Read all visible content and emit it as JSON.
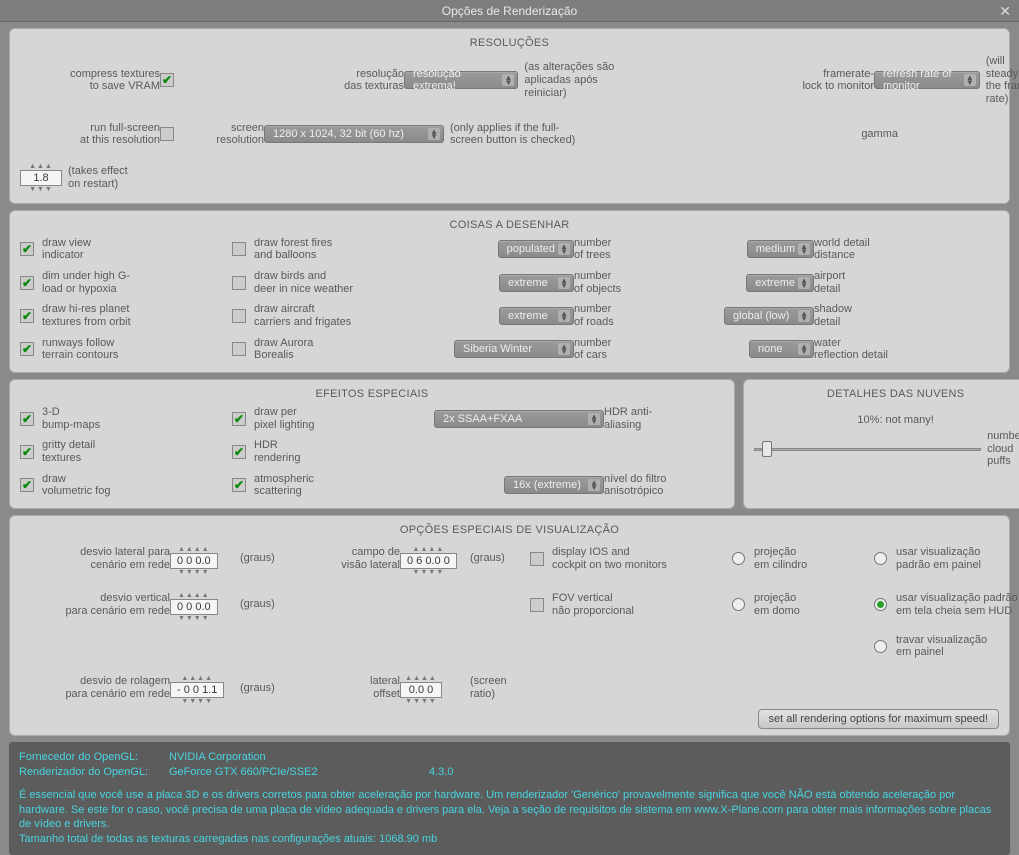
{
  "title": "Opções de Renderização",
  "sections": {
    "res": {
      "title": "RESOLUÇÕES",
      "compress": {
        "l1": "compress textures",
        "l2": "to save VRAM",
        "checked": true
      },
      "texres": {
        "l1": "resolução",
        "l2": "das texturas",
        "value": "resolução extrema!",
        "note1": "(as alterações são",
        "note2": "aplicadas após reiniciar)"
      },
      "fps": {
        "l1": "framerate-",
        "l2": "lock to monitor",
        "value": "refresh rate of monitor",
        "note1": "(will steady",
        "note2": "the frame-rate)"
      },
      "runfs": {
        "l1": "run full-screen",
        "l2": "at this resolution",
        "checked": false
      },
      "screen": {
        "l1": "screen",
        "l2": "resolution",
        "value": "1280 x 1024, 32 bit (60 hz)",
        "note1": "(only applies if the full-",
        "note2": "screen button is checked)"
      },
      "gamma": {
        "label": "gamma",
        "value": "1.8",
        "note1": "(takes effect",
        "note2": "on restart)"
      }
    },
    "draw": {
      "title": "COISAS A DESENHAR",
      "chk": [
        {
          "l1": "draw view",
          "l2": "indicator",
          "checked": true
        },
        {
          "l1": "dim under high G-",
          "l2": "load or hypoxia",
          "checked": true
        },
        {
          "l1": "draw hi-res planet",
          "l2": "textures from orbit",
          "checked": true
        },
        {
          "l1": "runways follow",
          "l2": "terrain contours",
          "checked": true
        },
        {
          "l1": "draw forest fires",
          "l2": "and balloons",
          "checked": false
        },
        {
          "l1": "draw birds and",
          "l2": "deer in nice weather",
          "checked": false
        },
        {
          "l1": "draw aircraft",
          "l2": "carriers and frigates",
          "checked": false
        },
        {
          "l1": "draw Aurora",
          "l2": "Borealis",
          "checked": false
        }
      ],
      "cb": [
        {
          "val": "populated",
          "l1": "number",
          "l2": "of trees"
        },
        {
          "val": "extreme",
          "l1": "number",
          "l2": "of objects"
        },
        {
          "val": "extreme",
          "l1": "number",
          "l2": "of roads"
        },
        {
          "val": "Siberia Winter",
          "l1": "number",
          "l2": "of cars"
        },
        {
          "val": "medium",
          "l1": "world detail",
          "l2": "distance"
        },
        {
          "val": "extreme",
          "l1": "airport",
          "l2": "detail"
        },
        {
          "val": "global (low)",
          "l1": "shadow",
          "l2": "detail"
        },
        {
          "val": "none",
          "l1": "water",
          "l2": "reflection detail"
        }
      ]
    },
    "fx": {
      "title": "EFEITOS ESPECIAIS",
      "chk": [
        {
          "l1": "3-D",
          "l2": "bump-maps",
          "checked": true
        },
        {
          "l1": "gritty detail",
          "l2": "textures",
          "checked": true
        },
        {
          "l1": "draw",
          "l2": "volumetric fog",
          "checked": true
        },
        {
          "l1": "draw per",
          "l2": "pixel lighting",
          "checked": true
        },
        {
          "l1": "HDR",
          "l2": "rendering",
          "checked": true
        },
        {
          "l1": "atmospheric",
          "l2": "scattering",
          "checked": true
        }
      ],
      "cb": [
        {
          "val": "2x SSAA+FXAA",
          "l1": "HDR anti-",
          "l2": "aliasing"
        },
        {
          "val": "16x (extreme)",
          "l1": "nível do filtro",
          "l2": "anisotrópico"
        }
      ]
    },
    "clouds": {
      "title": "DETALHES DAS NUVENS",
      "slider_label": "10%: not many!",
      "note1": "number of",
      "note2": "cloud puffs"
    },
    "vis": {
      "title": "OPÇÕES ESPECIAIS DE VISUALIZAÇÃO",
      "sp": [
        {
          "l1": "desvio lateral para",
          "l2": "cenário em rede",
          "val": "0 0 0.0",
          "unit": "(graus)"
        },
        {
          "l1": "desvio vertical",
          "l2": "para cenário em rede",
          "val": "0 0 0.0",
          "unit": "(graus)"
        },
        {
          "l1": "desvio de rolagem",
          "l2": "para cenário em rede",
          "val": "- 0 0 1.1",
          "unit": "(graus)"
        },
        {
          "l1": "campo de",
          "l2": "visão lateral",
          "val": "0 6 0.0 0",
          "unit": "(graus)"
        },
        {
          "l1": "lateral",
          "l2": "offset",
          "val": "0.0 0",
          "unit1": "(screen",
          "unit2": "ratio)"
        }
      ],
      "chk": [
        {
          "l1": "display IOS and",
          "l2": "cockpit on two monitors",
          "checked": false
        },
        {
          "l1": "FOV vertical",
          "l2": "não proporcional",
          "checked": false
        }
      ],
      "rad1": [
        {
          "l1": "projeção",
          "l2": "em cilindro",
          "checked": false
        },
        {
          "l1": "projeção",
          "l2": "em domo",
          "checked": false
        }
      ],
      "rad2": [
        {
          "l1": "usar visualização",
          "l2": "padrão em painel",
          "checked": false
        },
        {
          "l1": "usar visualização padrão",
          "l2": "em tela cheia sem HUD",
          "checked": true
        },
        {
          "l1": "travar visualização",
          "l2": "em painel",
          "checked": false
        }
      ],
      "btn": "set all rendering options for maximum speed!"
    },
    "info": {
      "vendor_l": "Fornecedor do OpenGL:",
      "vendor_v": "NVIDIA Corporation",
      "render_l": "Renderizador do OpenGL:",
      "render_v": "GeForce GTX 660/PCIe/SSE2",
      "version": "4.3.0",
      "blurb": "É essencial que você use a placa 3D e os drivers corretos para obter aceleração por hardware. Um renderizador 'Genérico' provavelmente significa que você NÃO está obtendo aceleração por hardware. Se este for o caso, você precisa de uma placa de vídeo adequada e drivers para ela. Veja a seção de requisitos de sistema em www.X-Plane.com para obter mais informações sobre placas de vídeo e drivers.",
      "texsize": "Tamanho total de todas as texturas carregadas nas configurações atuais: 1068.90 mb"
    }
  }
}
